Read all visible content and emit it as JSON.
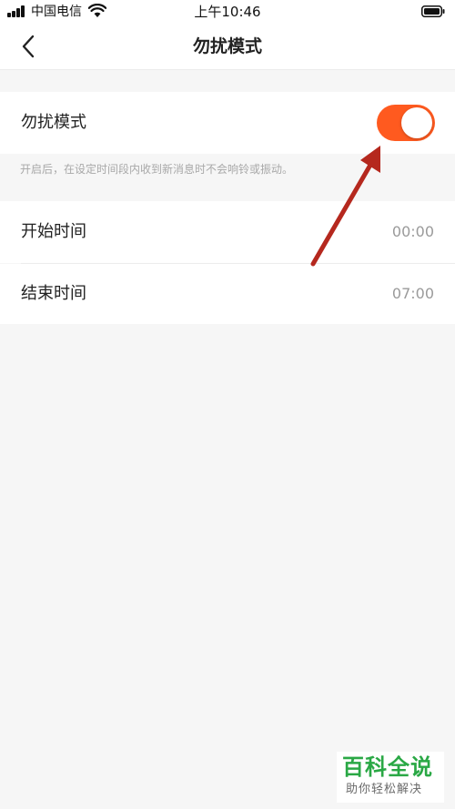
{
  "status_bar": {
    "carrier": "中国电信",
    "time": "上午10:46",
    "signal_icon": "signal-bars-icon",
    "wifi_icon": "wifi-icon",
    "battery_icon": "battery-icon"
  },
  "nav": {
    "back_icon": "chevron-left-icon",
    "title": "勿扰模式"
  },
  "dnd": {
    "label": "勿扰模式",
    "enabled": true,
    "hint": "开启后，在设定时间段内收到新消息时不会响铃或振动。"
  },
  "schedule": {
    "start_label": "开始时间",
    "start_value": "00:00",
    "end_label": "结束时间",
    "end_value": "07:00"
  },
  "watermark": {
    "main": "百科全说",
    "sub": "助你轻松解决"
  },
  "colors": {
    "accent": "#ff5a1f",
    "arrow": "#b5281e",
    "watermark_green": "#2aa845"
  }
}
